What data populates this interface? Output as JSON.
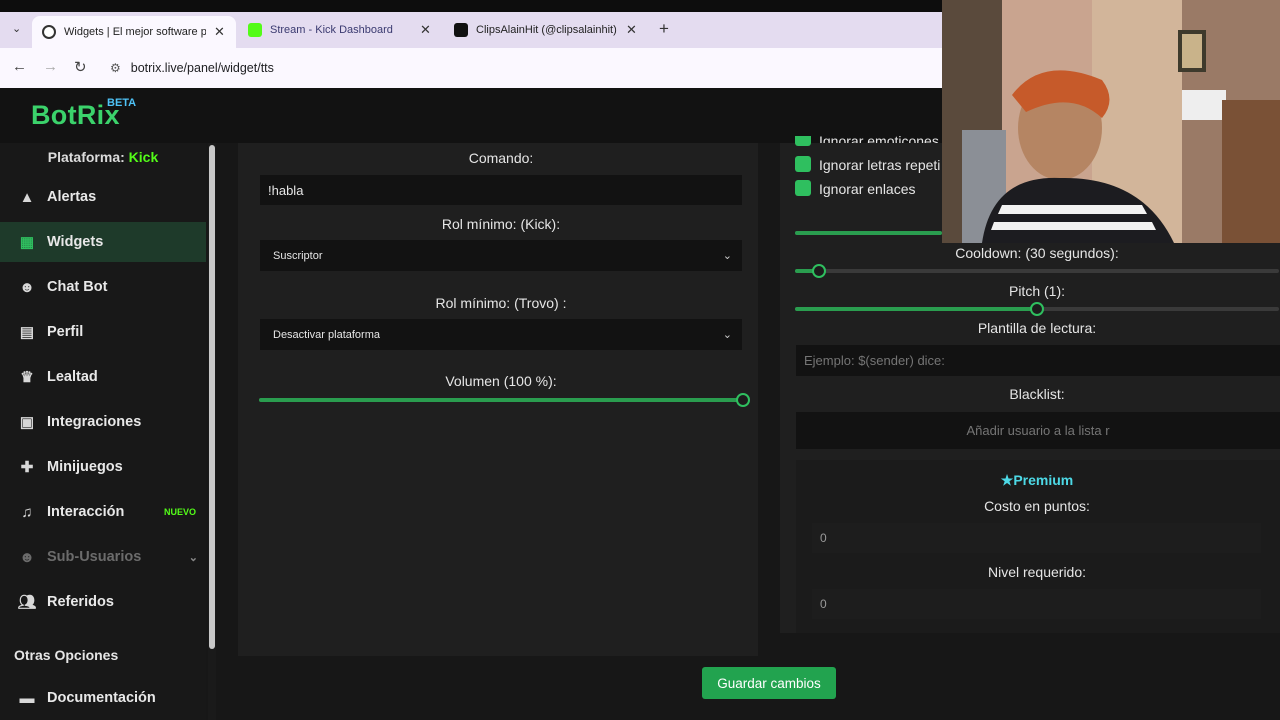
{
  "browser": {
    "tabs": [
      {
        "title": "Widgets | El mejor software par",
        "active": true
      },
      {
        "title": "Stream - Kick Dashboard",
        "active": false
      },
      {
        "title": "ClipsAlainHit (@clipsalainhit) | T",
        "active": false
      }
    ],
    "new_tab_symbol": "+",
    "url": "botrix.live/panel/widget/tts"
  },
  "app": {
    "logo": "BotRix",
    "beta": "BETA",
    "platform_label": "Plataforma:",
    "platform_value": "Kick"
  },
  "sidebar": {
    "items": [
      {
        "label": "Alertas",
        "icon": "warning-icon"
      },
      {
        "label": "Widgets",
        "icon": "grid-icon"
      },
      {
        "label": "Chat Bot",
        "icon": "robot-icon"
      },
      {
        "label": "Perfil",
        "icon": "id-card-icon"
      },
      {
        "label": "Lealtad",
        "icon": "trophy-icon"
      },
      {
        "label": "Integraciones",
        "icon": "image-icon"
      },
      {
        "label": "Minijuegos",
        "icon": "gamepad-icon"
      },
      {
        "label": "Interacción",
        "icon": "music-icon",
        "badge": "NUEVO"
      },
      {
        "label": "Sub-Usuarios",
        "icon": "robot-icon"
      },
      {
        "label": "Referidos",
        "icon": "users-icon"
      }
    ],
    "section_title": "Otras Opciones",
    "doc_item": "Documentación"
  },
  "left_panel": {
    "command_label": "Comando:",
    "command_value": "!habla",
    "kick_role_label": "Rol mínimo: (Kick):",
    "kick_role_value": "Suscriptor",
    "trovo_role_label": "Rol mínimo: (Trovo) :",
    "trovo_role_value": "Desactivar plataforma",
    "volume_label": "Volumen (100 %):",
    "volume_value": 1.0
  },
  "right_panel": {
    "checks": [
      {
        "label": "Ignorar emoticones"
      },
      {
        "label": "Ignorar letras repeti"
      },
      {
        "label": "Ignorar enlaces"
      }
    ],
    "top_slider_value": 1.0,
    "cooldown_label": "Cooldown: (30 segundos):",
    "cooldown_value": 0.05,
    "pitch_label": "Pitch (1):",
    "pitch_value": 0.5,
    "template_label": "Plantilla de lectura:",
    "template_placeholder": "Ejemplo: $(sender) dice:",
    "blacklist_label": "Blacklist:",
    "blacklist_placeholder": "Añadir usuario a la lista r",
    "premium_label": "Premium",
    "cost_label": "Costo en puntos:",
    "cost_value": "0",
    "level_label": "Nivel requerido:",
    "level_value": "0"
  },
  "footer": {
    "save_label": "Guardar cambios"
  },
  "colors": {
    "accent": "#2fbf5f",
    "kick": "#53fc18",
    "beta": "#4fc3f7",
    "premium": "#4dd9e6"
  }
}
